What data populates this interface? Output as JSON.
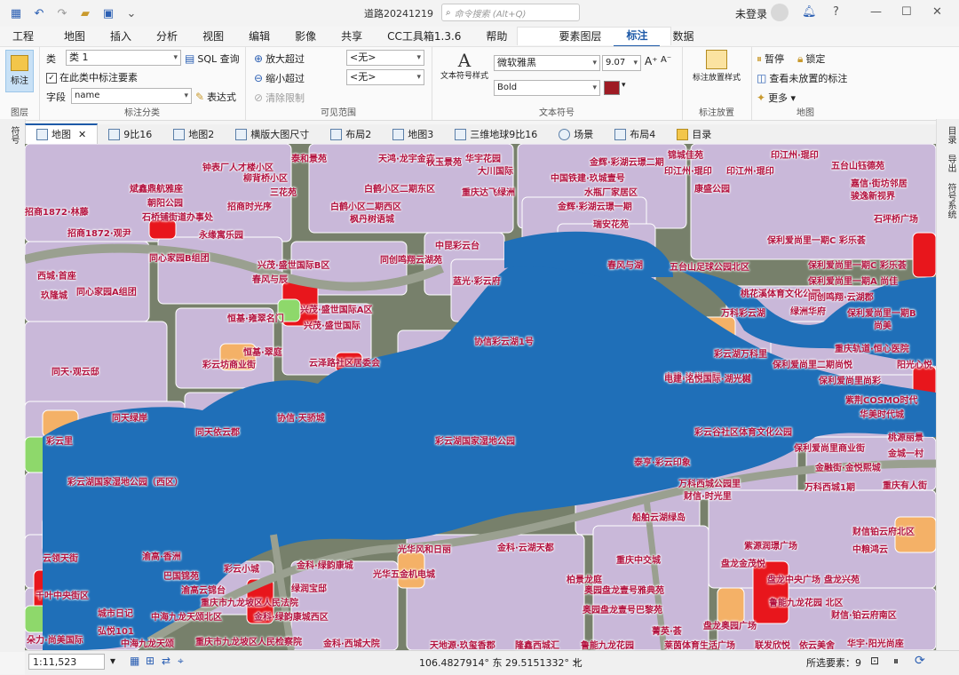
{
  "window": {
    "title": "道路20241219",
    "search_placeholder": "命令搜索 (Alt+Q)",
    "user": "未登录"
  },
  "ribbon_tabs": [
    "工程",
    "地图",
    "插入",
    "分析",
    "视图",
    "编辑",
    "影像",
    "共享",
    "CC工具箱1.3.6",
    "帮助"
  ],
  "context_tabs": [
    "要素图层",
    "标注",
    "数据"
  ],
  "ribbon": {
    "label_btn": "标注",
    "layer_group": "图层",
    "class_label": "类",
    "class_value": "类 1",
    "sql_label": "SQL 查询",
    "label_in_class": "在此类中标注要素",
    "field_label": "字段",
    "field_value": "name",
    "expression_label": "表达式",
    "label_class_group": "标注分类",
    "zoom_in_beyond": "放大超过",
    "zoom_out_beyond": "缩小超过",
    "clear_limits": "清除限制",
    "none1": "<无>",
    "none2": "<无>",
    "visible_range_group": "可见范围",
    "text_symbol_style": "文本符号样式",
    "font_name": "微软雅黑",
    "font_size": "9.07",
    "font_style": "Bold",
    "text_symbol_group": "文本符号",
    "label_placement_style": "标注放置样式",
    "label_placement_group": "标注放置",
    "pause": "暂停",
    "lock": "锁定",
    "view_unplaced": "查看未放置的标注",
    "more": "更多",
    "map_group": "地图",
    "font_color": "#9e1b24"
  },
  "view_tabs": [
    "地图",
    "9比16",
    "地图2",
    "横版大图尺寸",
    "布局2",
    "地图3",
    "三维地球9比16",
    "场景",
    "布局4",
    "目录"
  ],
  "left_panes": [
    "符号"
  ],
  "right_panes": [
    "目录",
    "导出",
    "符号系统"
  ],
  "map_labels": [
    "钟表厂人才楼小区",
    "泰和景苑",
    "天鸿·龙宇金座",
    "秋玉景苑",
    "华宇花园",
    "大川国际",
    "锦城佳苑",
    "印江州·琨印",
    "五台山钰德苑",
    "斌鑫鼎航雅座",
    "柳背桥小区",
    "三花苑",
    "白鹤小区二期东区",
    "重庆达飞绿洲",
    "中国铁建·玖城壹号",
    "金辉·彩湖云璟二期",
    "印江州·琨印",
    "印江州·琨印",
    "嘉信·街坊邻居",
    "朝阳公园",
    "招商1872·林藤",
    "石桥铺街道办事处",
    "招商时光序",
    "白鹤小区二期西区",
    "水瓶厂家居区",
    "金辉·彩湖云璟一期",
    "康盛公园",
    "骏逸新视界",
    "招商1872·观尹",
    "永缘寓乐园",
    "枫丹树语城",
    "瑞安花苑",
    "石坪桥广场",
    "同心家园B组团",
    "中昆彩云台",
    "保利爱尚里一期C 彩乐荟",
    "西城·首座",
    "兴茂·盛世国际B区",
    "同创鸣翔云湖苑",
    "春风与湖",
    "五台山足球公园北区",
    "保利爱尚里一期C 彩乐荟",
    "玖隆城",
    "同心家园A组团",
    "春风与辰",
    "蓝光·彩云府",
    "保利爱尚里一期A 尚佳",
    "兴茂·盛世国际A区",
    "桃花溪体育文化公园",
    "同创鸣翔·云湖郡",
    "恒基·雍翠名门",
    "兴茂·盛世国际",
    "万科彩云湖",
    "绿洲华府",
    "保利爱尚里一期B",
    "尚美",
    "协信彩云湖1号",
    "电建·洺悦国际",
    "重庆轨道·恒心医院",
    "恒基·翠庭",
    "彩云湖万科里",
    "彩云坊商业街",
    "云泽路社区居委会",
    "保利爱尚里二期尚悦",
    "阳光心悦",
    "同天·观云邸",
    "电建·洺悦国际·湖光樾",
    "保利爱尚里尚彩",
    "紫荆COSMO时代",
    "华美时代城",
    "同天绿岸",
    "协信·天骄城",
    "同天依云郡",
    "彩云谷社区体育文化公园",
    "桃源丽景",
    "彩云里",
    "彩云湖国家湿地公园",
    "保利爱尚里商业街",
    "金城一村",
    "泰亨·彩云印象",
    "金融街·金悦熙城",
    "彩云湖国家湿地公园（西区）",
    "万科西城公园里",
    "万科西城1期",
    "重庆有人街",
    "财信·时光里",
    "船舶云湖绿岛",
    "财信铂云府北区",
    "云领天街",
    "光华风和日丽",
    "金科·云湖天都",
    "紫源润璟广场",
    "中粮鸿云",
    "渝高·香洲",
    "重庆中交城",
    "盘龙金茂悦",
    "巴国锦苑",
    "彩云小城",
    "金科·绿韵康城",
    "光华五金机电城",
    "柏景龙庭",
    "渝高云锦台",
    "绿润宝邸",
    "奥园盘龙壹号雅典苑",
    "鲁能九龙花园 北区",
    "盘龙兴苑",
    "千叶中央街区",
    "重庆市九龙坡区人民法院",
    "盘龙中央广场",
    "城市日记",
    "中海九龙天颂北区",
    "金科·绿韵康城西区",
    "奥园盘龙壹号巴黎苑",
    "财信·铂云府南区",
    "弘悦101",
    "菁英·荟",
    "盘龙奥园广场",
    "朵力·尚美国际",
    "中海九龙天颂",
    "重庆市九龙坡区人民检察院",
    "金科·西城大院",
    "天地源·玖玺香郡",
    "隆鑫西城汇",
    "鲁能九龙花园",
    "莱茵体育生活广场",
    "联发欣悦",
    "依云美舍",
    "华宇·阳光尚座"
  ],
  "status": {
    "scale": "1:11,523",
    "coords": "106.4827914° 东  29.5151332° 北",
    "selected_label": "所选要素：",
    "selected_count": "9"
  },
  "colors": {
    "water": "#1f6fb8",
    "parcel": "#c9b8d9",
    "hot": "#e8161c",
    "orange": "#f4b167",
    "green": "#8ed86b",
    "label": "#b3123f"
  }
}
